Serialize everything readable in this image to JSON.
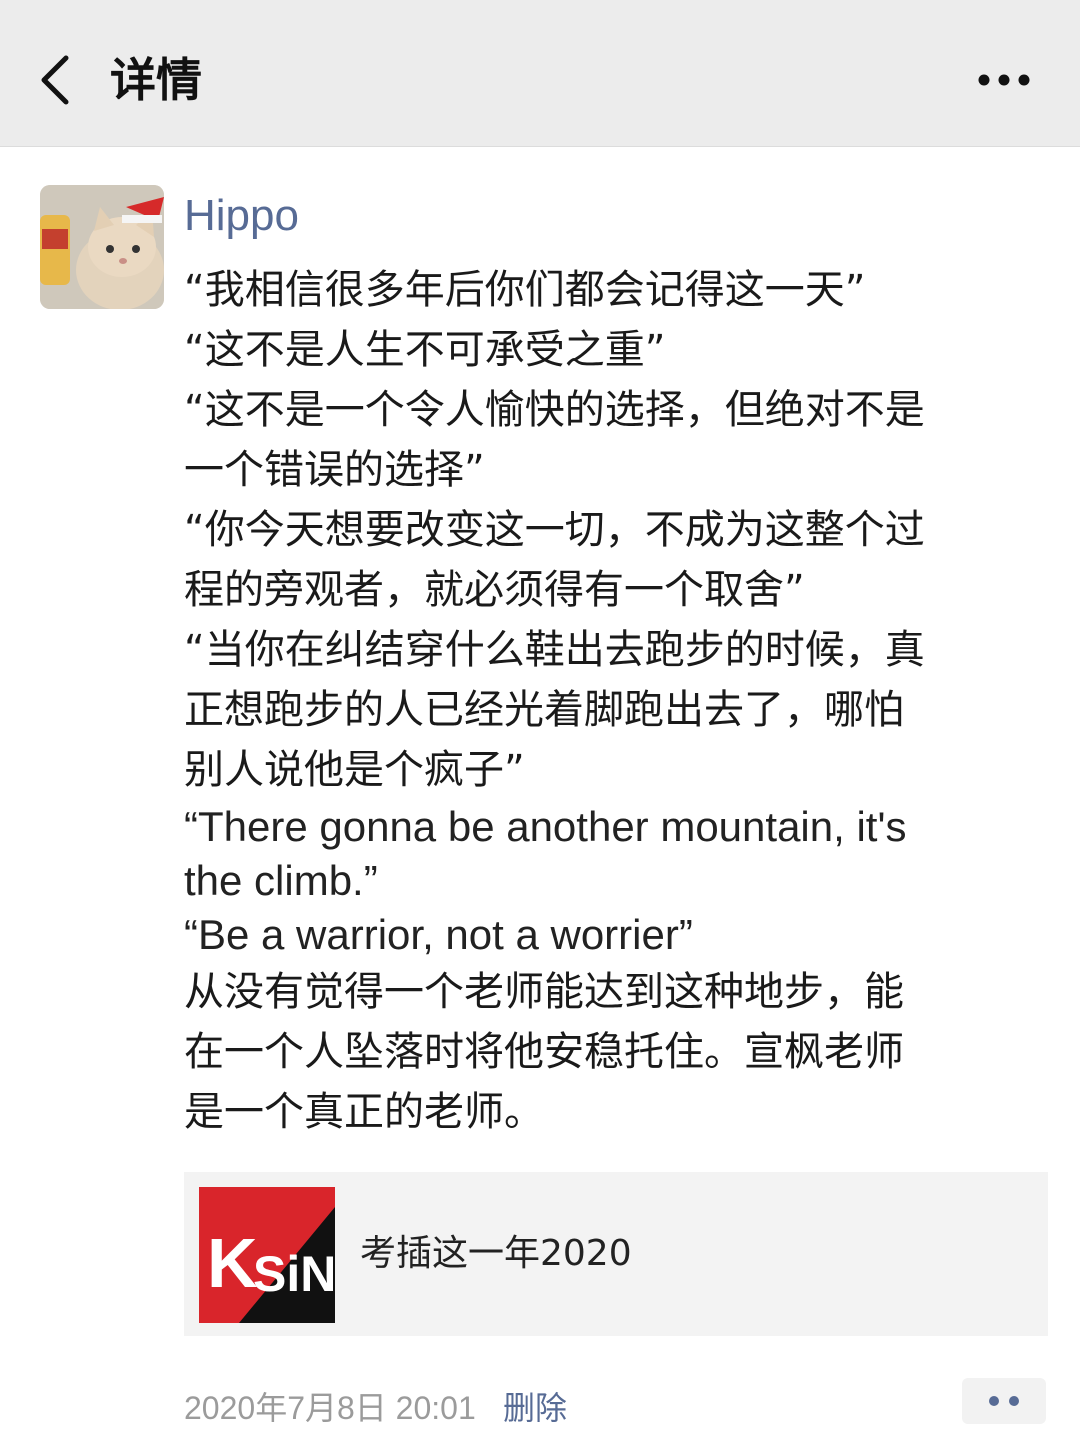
{
  "nav": {
    "title": "详情",
    "back_icon": "chevron-left-icon",
    "more_icon": "more-horizontal-icon"
  },
  "post": {
    "avatar_icon": "cat-avatar",
    "username": "Hippo",
    "lines": [
      "“我相信很多年后你们都会记得这一天”",
      "“这不是人生不可承受之重”",
      "“这不是一个令人愉快的选择，但绝对不是",
      "一个错误的选择”",
      "“你今天想要改变这一切，不成为这整个过",
      "程的旁观者，就必须得有一个取舍”",
      "“当你在纠结穿什么鞋出去跑步的时候，真",
      "正想跑步的人已经光着脚跑出去了，哪怕",
      "别人说他是个疯子”",
      "“There gonna be another mountain, it's",
      "the climb.”",
      "“Be a warrior, not a worrier”",
      "从没有觉得一个老师能达到这种地步，能",
      "在一个人坠落时将他安稳托住。宣枫老师",
      "是一个真正的老师。"
    ],
    "share": {
      "logo_text": "KSiNG",
      "title": "考插这一年2020"
    },
    "timestamp": "2020年7月8日 20:01",
    "delete_label": "删除",
    "comment_icon": "two-dots-icon"
  },
  "colors": {
    "nav_bg": "#ececec",
    "link": "#576b95",
    "logo_red": "#d9252b",
    "logo_black": "#111111"
  }
}
